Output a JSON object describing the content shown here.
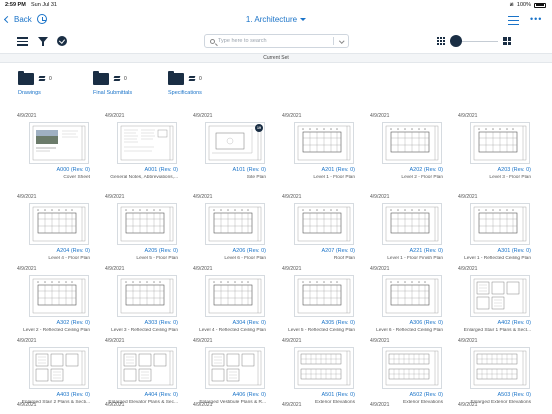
{
  "status_bar": {
    "time": "2:59 PM",
    "date": "Sun Jul 31",
    "battery": "100%"
  },
  "nav": {
    "back_label": "Back",
    "title": "1. Architecture"
  },
  "search": {
    "placeholder": "Type here to search"
  },
  "current_set_label": "Current Set",
  "folders": [
    {
      "name": "Drawings",
      "count": "0"
    },
    {
      "name": "Final Submittals",
      "count": "0"
    },
    {
      "name": "Specifications",
      "count": "0"
    }
  ],
  "sheets": [
    {
      "date": "4/9/2021",
      "number": "A000 (Rev. 0)",
      "title": "Cover Sheet",
      "thumb": "cover"
    },
    {
      "date": "4/9/2021",
      "number": "A001 (Rev. 0)",
      "title": "General Notes, Abbreviations,...",
      "thumb": "notes"
    },
    {
      "date": "4/9/2021",
      "number": "A101 (Rev. 0)",
      "title": "Site Plan",
      "thumb": "site",
      "badge": "19"
    },
    {
      "date": "4/9/2021",
      "number": "A201 (Rev. 0)",
      "title": "Level 1 - Floor Plan",
      "thumb": "plan"
    },
    {
      "date": "4/9/2021",
      "number": "A202 (Rev. 0)",
      "title": "Level 2 - Floor Plan",
      "thumb": "plan"
    },
    {
      "date": "4/9/2021",
      "number": "A203 (Rev. 0)",
      "title": "Level 3 - Floor Plan",
      "thumb": "plan"
    },
    {
      "date": "4/9/2021",
      "number": "A204 (Rev. 0)",
      "title": "Level 4 - Floor Plan",
      "thumb": "plan"
    },
    {
      "date": "4/9/2021",
      "number": "A205 (Rev. 0)",
      "title": "Level 5 - Floor Plan",
      "thumb": "plan"
    },
    {
      "date": "4/9/2021",
      "number": "A206 (Rev. 0)",
      "title": "Level 6 - Floor Plan",
      "thumb": "plan"
    },
    {
      "date": "4/9/2021",
      "number": "A207 (Rev. 0)",
      "title": "Roof Plan",
      "thumb": "plan"
    },
    {
      "date": "4/9/2021",
      "number": "A221 (Rev. 0)",
      "title": "Level 1 - Floor Finish Plan",
      "thumb": "plan"
    },
    {
      "date": "4/9/2021",
      "number": "A301 (Rev. 0)",
      "title": "Level 1 - Reflected Ceiling Plan",
      "thumb": "plan"
    },
    {
      "date": "4/9/2021",
      "number": "A302 (Rev. 0)",
      "title": "Level 2 - Reflected Ceiling Plan",
      "thumb": "plan"
    },
    {
      "date": "4/9/2021",
      "number": "A303 (Rev. 0)",
      "title": "Level 3 - Reflected Ceiling Plan",
      "thumb": "plan"
    },
    {
      "date": "4/9/2021",
      "number": "A304 (Rev. 0)",
      "title": "Level 4 - Reflected Ceiling Plan",
      "thumb": "plan"
    },
    {
      "date": "4/9/2021",
      "number": "A305 (Rev. 0)",
      "title": "Level 5 - Reflected Ceiling Plan",
      "thumb": "plan"
    },
    {
      "date": "4/9/2021",
      "number": "A306 (Rev. 0)",
      "title": "Level 6 - Reflected Ceiling Plan",
      "thumb": "plan"
    },
    {
      "date": "4/9/2021",
      "number": "A402 (Rev. 0)",
      "title": "Enlarged Stair 1 Plans & Sect...",
      "thumb": "detail"
    },
    {
      "date": "4/9/2021",
      "number": "A403 (Rev. 0)",
      "title": "Enlarged Stair 2 Plans & Secti...",
      "thumb": "detail"
    },
    {
      "date": "4/9/2021",
      "number": "A404 (Rev. 0)",
      "title": "Enlarged Elevator Plans & Sec...",
      "thumb": "detail"
    },
    {
      "date": "4/9/2021",
      "number": "A406 (Rev. 0)",
      "title": "Enlarged Vestibule Plans & R...",
      "thumb": "detail"
    },
    {
      "date": "4/9/2021",
      "number": "A501 (Rev. 0)",
      "title": "Exterior Elevations",
      "thumb": "elev"
    },
    {
      "date": "4/9/2021",
      "number": "A502 (Rev. 0)",
      "title": "Exterior Elevations",
      "thumb": "elev"
    },
    {
      "date": "4/9/2021",
      "number": "A503 (Rev. 0)",
      "title": "Enlarged Exterior Elevations",
      "thumb": "elev"
    },
    {
      "date": "4/9/2021"
    },
    {
      "date": "4/9/2021"
    },
    {
      "date": "4/9/2021"
    },
    {
      "date": "4/9/2021"
    },
    {
      "date": "4/9/2021"
    },
    {
      "date": "4/9/2021"
    }
  ],
  "colors": {
    "accent": "#1a73c8",
    "icon": "#1a2e44",
    "border": "#d6dbe0"
  }
}
